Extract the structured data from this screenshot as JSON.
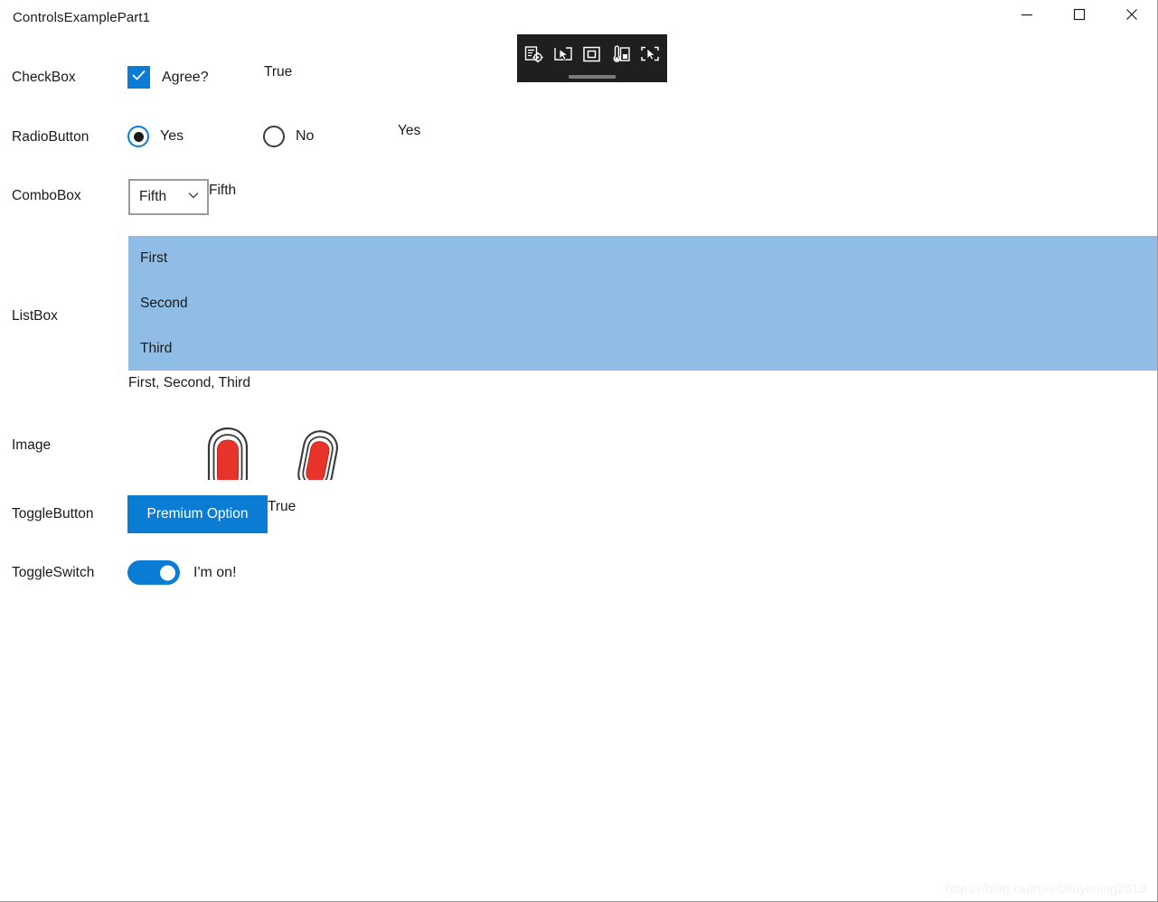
{
  "window": {
    "title": "ControlsExamplePart1",
    "caption_buttons": [
      {
        "name": "minimize",
        "glyph": "minimize-icon"
      },
      {
        "name": "maximize",
        "glyph": "maximize-icon"
      },
      {
        "name": "close",
        "glyph": "close-icon"
      }
    ]
  },
  "colors": {
    "accent_blue": "#0a7cd4",
    "listbox_selection": "#8fbde6",
    "combobox_border": "#9b9b9b",
    "toolbar_background": "#1f1f1f",
    "image_red": "#e8332a",
    "text": "#1b1b1b",
    "watermark": "#eff1f3"
  },
  "rows": {
    "checkbox": {
      "label": "CheckBox",
      "content_label": "Agree?",
      "checked": true,
      "value": "True"
    },
    "radiobutton": {
      "label": "RadioButton",
      "options": [
        {
          "label": "Yes",
          "checked": true
        },
        {
          "label": "No",
          "checked": false
        }
      ],
      "value": "Yes"
    },
    "combobox": {
      "label": "ComboBox",
      "selected": "Fifth",
      "value": "Fifth"
    },
    "listbox": {
      "label": "ListBox",
      "items": [
        "First",
        "Second",
        "Third"
      ],
      "value": "First, Second, Third"
    },
    "image": {
      "label": "Image",
      "images": [
        "map-pin-image",
        "map-pin-image"
      ]
    },
    "togglebutton": {
      "label": "ToggleButton",
      "content": "Premium Option",
      "checked": true,
      "value": "True"
    },
    "toggleswitch": {
      "label": "ToggleSwitch",
      "on": true,
      "content": "I'm on!"
    }
  },
  "dev_toolbar": {
    "icons": [
      "go-to-live-visual-tree-icon",
      "select-element-icon",
      "display-layout-adorners-icon",
      "track-focused-element-icon",
      "preview-selection-icon"
    ]
  },
  "watermark": {
    "text": "https://blog.csdn.net/liuyiming2019"
  }
}
